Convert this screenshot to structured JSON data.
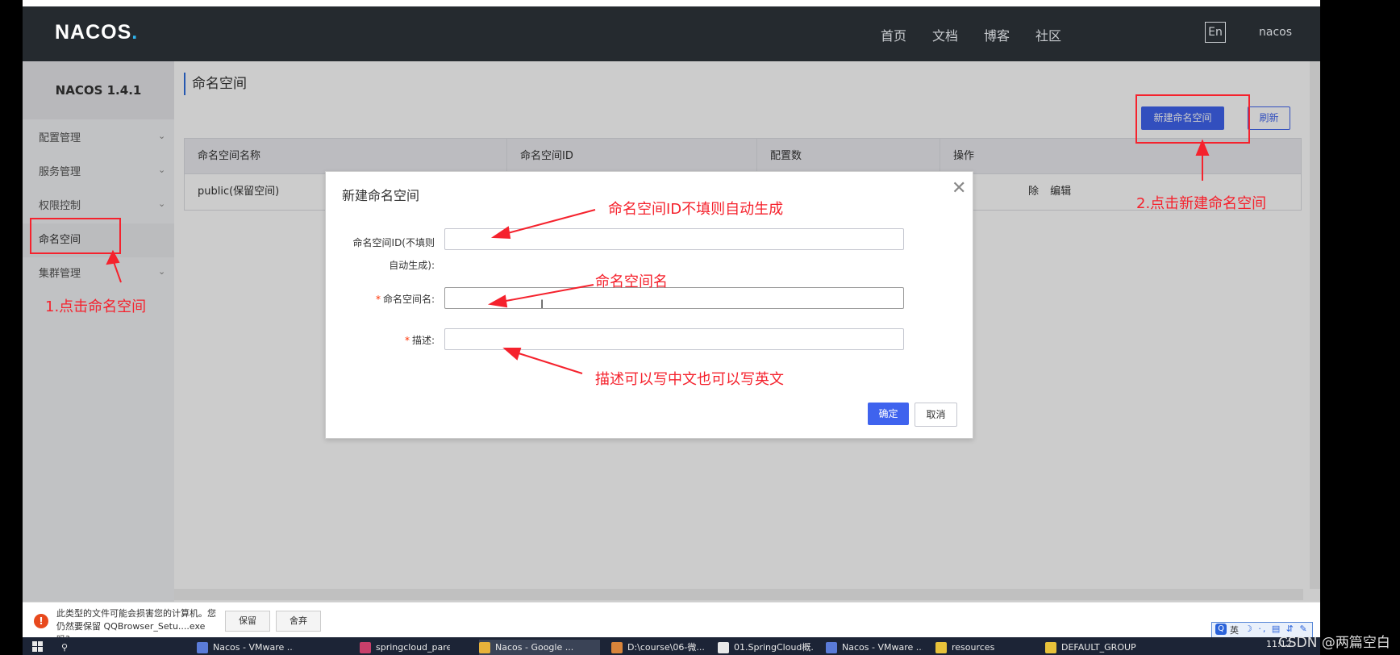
{
  "navbar": {
    "logo": "NACOS",
    "logo_dot": ".",
    "links": [
      "首页",
      "文档",
      "博客",
      "社区"
    ],
    "lang": "En",
    "user": "nacos"
  },
  "sidebar": {
    "version": "NACOS 1.4.1",
    "items": [
      {
        "label": "配置管理"
      },
      {
        "label": "服务管理"
      },
      {
        "label": "权限控制"
      },
      {
        "label": "命名空间"
      },
      {
        "label": "集群管理"
      }
    ]
  },
  "page": {
    "title": "命名空间",
    "new_button": "新建命名空间",
    "refresh_button": "刷新"
  },
  "table": {
    "headers": [
      "命名空间名称",
      "命名空间ID",
      "配置数",
      "操作"
    ],
    "rows": [
      {
        "name": "public(保留空间)",
        "ops": [
          "除",
          "编辑"
        ]
      }
    ]
  },
  "modal": {
    "title": "新建命名空间",
    "close": "✕",
    "id_label_line1": "命名空间ID(不填则",
    "id_label_line2": "自动生成):",
    "name_label": "命名空间名:",
    "desc_label": "描述:",
    "required_mark": "*",
    "ok": "确定",
    "cancel": "取消"
  },
  "annotations": {
    "step1": "1.点击命名空间",
    "step2": "2.点击新建命名空间",
    "id_note": "命名空间ID不填则自动生成",
    "name_note": "命名空间名",
    "desc_note": "描述可以写中文也可以写英文",
    "color": "#f5222d"
  },
  "download_bar": {
    "warning_line1": "此类型的文件可能会损害您的计算机。您",
    "warning_line2": "仍然要保留 QQBrowser_Setu....exe 吗?",
    "keep": "保留",
    "discard": "舍弃"
  },
  "ime": {
    "icon": "Q",
    "lang": "英",
    "rest": "☽ ·, ▤ ⇵ ✎"
  },
  "taskbar": {
    "items": [
      "Nacos - VMware ...",
      "springcloud_pare...",
      "Nacos - Google ...",
      "D:\\course\\06-微...",
      "01.SpringCloud概...",
      "Nacos - VMware ...",
      "resources",
      "DEFAULT_GROUP"
    ],
    "clock": "11:12"
  },
  "watermark": "CSDN @两篇空白"
}
